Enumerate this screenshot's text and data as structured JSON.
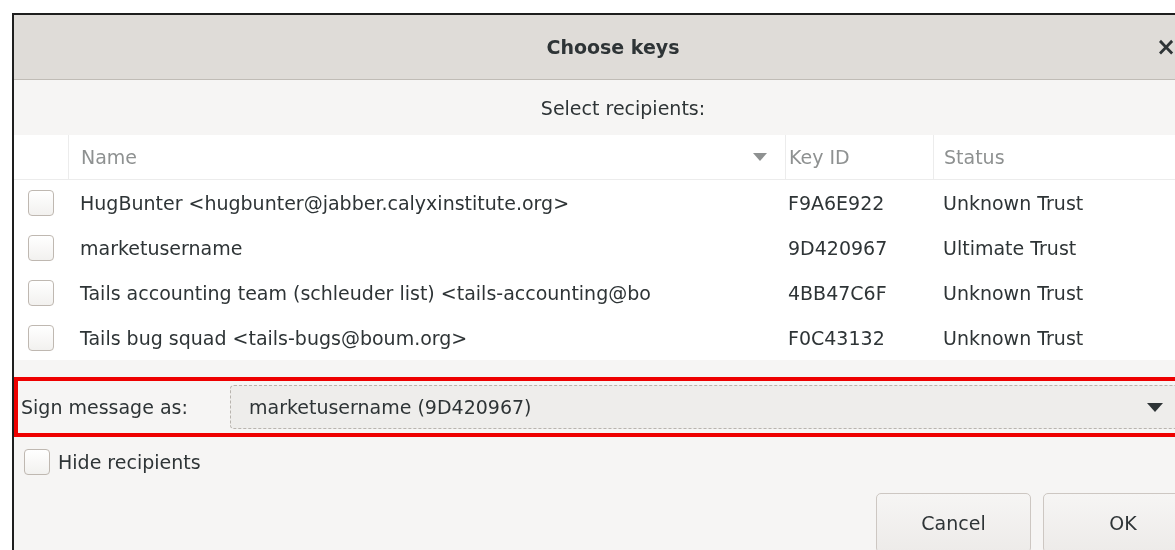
{
  "window": {
    "title": "Choose keys",
    "close": "×"
  },
  "prompt": "Select recipients:",
  "table": {
    "columns": [
      {
        "label": "Name",
        "sorted": true
      },
      {
        "label": "Key ID",
        "sorted": false
      },
      {
        "label": "Status",
        "sorted": false
      }
    ],
    "rows": [
      {
        "checked": false,
        "name": "HugBunter <hugbunter@jabber.calyxinstitute.org>",
        "key_id": "F9A6E922",
        "status": "Unknown Trust"
      },
      {
        "checked": false,
        "name": "marketusername",
        "key_id": "9D420967",
        "status": "Ultimate Trust"
      },
      {
        "checked": false,
        "name": "Tails accounting team (schleuder list) <tails-accounting@bo",
        "key_id": "4BB47C6F",
        "status": "Unknown Trust"
      },
      {
        "checked": false,
        "name": "Tails bug squad <tails-bugs@boum.org>",
        "key_id": "F0C43132",
        "status": "Unknown Trust"
      }
    ]
  },
  "sign": {
    "label": "Sign message as:",
    "value": "marketusername (9D420967)",
    "highlighted": true
  },
  "hide_recipients": {
    "label": "Hide recipients",
    "checked": false
  },
  "buttons": [
    {
      "label": "Cancel"
    },
    {
      "label": "OK"
    }
  ]
}
